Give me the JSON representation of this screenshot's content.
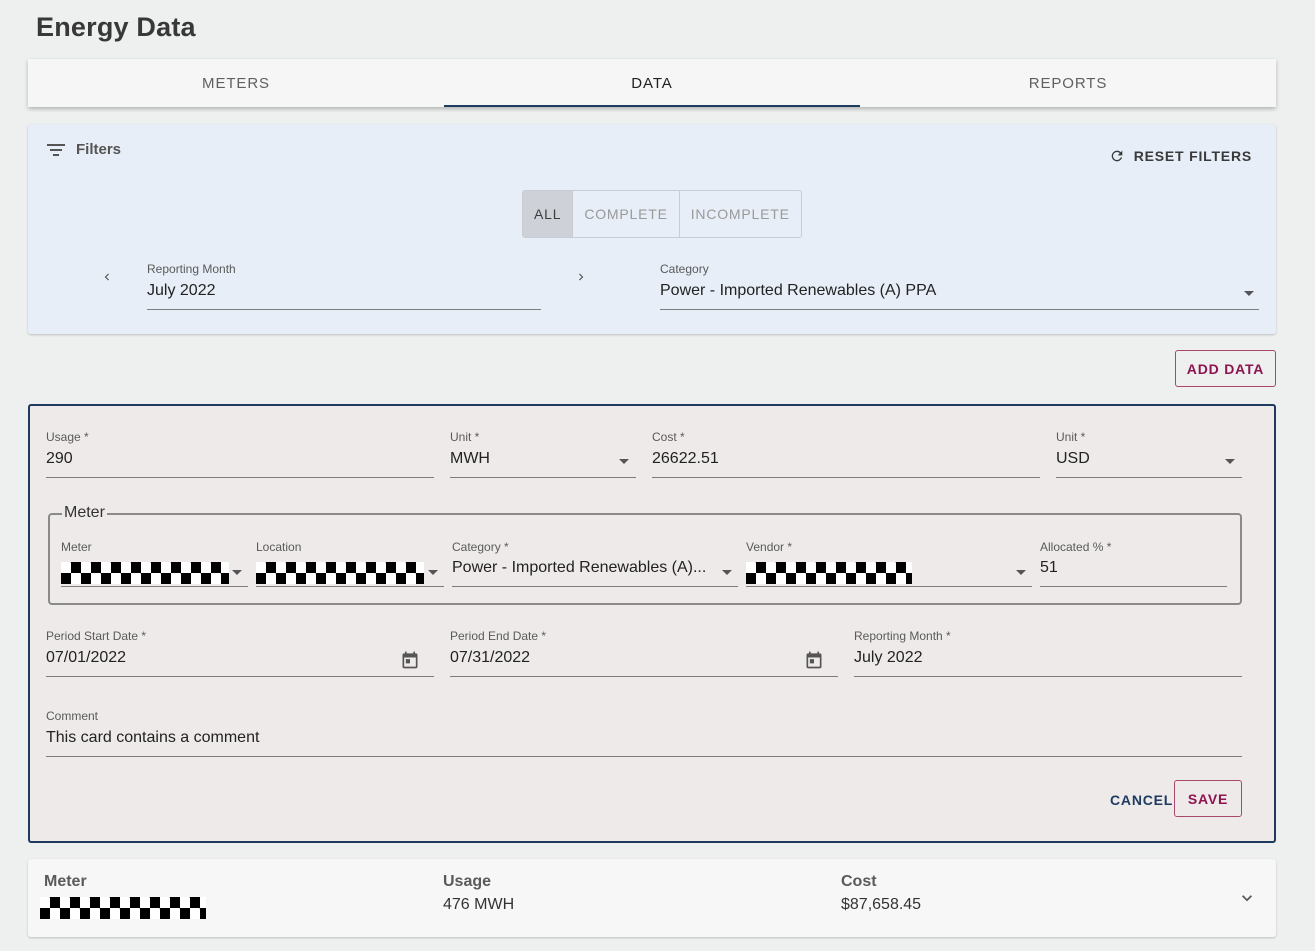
{
  "page": {
    "title": "Energy Data"
  },
  "tabs": [
    {
      "label": "METERS"
    },
    {
      "label": "DATA",
      "active": true
    },
    {
      "label": "REPORTS"
    }
  ],
  "filters": {
    "title": "Filters",
    "reset_label": "RESET FILTERS",
    "status_options": [
      "ALL",
      "COMPLETE",
      "INCOMPLETE"
    ],
    "status_selected": "ALL",
    "reporting_month": {
      "label": "Reporting Month",
      "value": "July 2022"
    },
    "category": {
      "label": "Category",
      "value": "Power - Imported Renewables (A) PPA"
    }
  },
  "add_data_label": "ADD DATA",
  "edit_card": {
    "usage": {
      "label": "Usage *",
      "value": "290"
    },
    "usage_unit": {
      "label": "Unit *",
      "value": "MWH"
    },
    "cost": {
      "label": "Cost *",
      "value": "26622.51"
    },
    "cost_unit": {
      "label": "Unit *",
      "value": "USD"
    },
    "meter_group": {
      "legend": "Meter",
      "meter_label": "Meter",
      "location_label": "Location",
      "category": {
        "label": "Category *",
        "value": "Power - Imported Renewables (A)..."
      },
      "vendor_label": "Vendor *",
      "allocated": {
        "label": "Allocated % *",
        "value": "51"
      }
    },
    "period_start": {
      "label": "Period Start Date *",
      "value": "07/01/2022"
    },
    "period_end": {
      "label": "Period End Date *",
      "value": "07/31/2022"
    },
    "reporting_month": {
      "label": "Reporting Month *",
      "value": "July 2022"
    },
    "comment": {
      "label": "Comment",
      "value": "This card contains a comment"
    },
    "cancel_label": "CANCEL",
    "save_label": "SAVE"
  },
  "summary_row": {
    "meter_label": "Meter",
    "usage_label": "Usage",
    "usage_value": "476 MWH",
    "cost_label": "Cost",
    "cost_value": "$87,658.45"
  },
  "colors": {
    "accent_navy": "#1e3a5f",
    "accent_magenta": "#8e1450",
    "filter_bg": "#e7eef7",
    "card_bg": "#eeeaea"
  }
}
